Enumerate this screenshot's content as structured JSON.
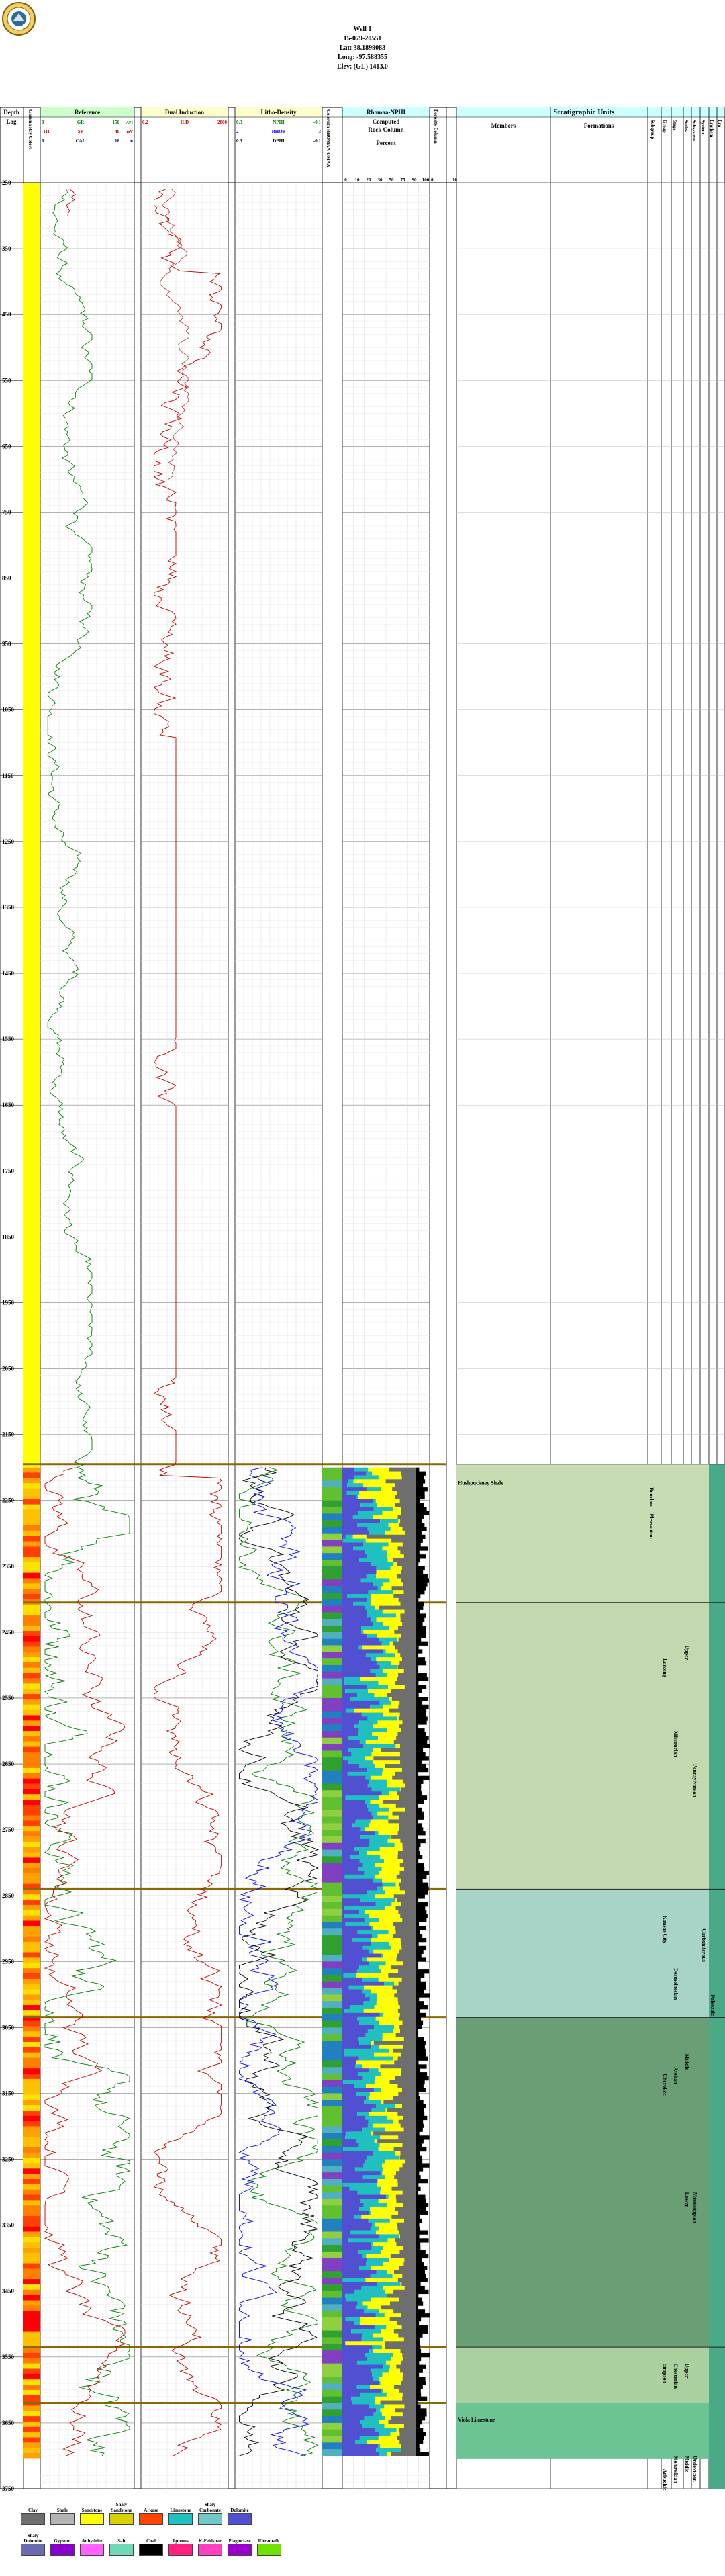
{
  "header": {
    "well_name": "Well 1",
    "api": "15-079-20551",
    "lat": "Lat: 38.1899083",
    "long": "Long: -97.588355",
    "elev": "Elev: (GL) 1413.0"
  },
  "columns": {
    "depth_title": "Depth",
    "depth_sub": "Log",
    "gr_col": "Gamma Ray Colors",
    "reference": "Reference",
    "dual_induction": "Dual Induction",
    "litho_density": "Litho-Density",
    "cali_col": "Colorlith RHOMAA-UMAA",
    "rhomaa": "Rhomaa-NPHI",
    "rhomaa_sub1": "Computed",
    "rhomaa_sub2": "Rock Column",
    "rhomaa_sub3": "Percent",
    "porosity": "Porosity Column",
    "porosity_scale": [
      "0",
      "10"
    ],
    "strat_title": "Stratigraphic Units",
    "members": "Members",
    "formations": "Formations",
    "strat_vertical": [
      "Subgroup",
      "Group",
      "Stage",
      "Series",
      "Subsystem",
      "System",
      "Erathem",
      "Era"
    ],
    "rhomaa_scale": [
      "0",
      "10",
      "20",
      "30",
      "50",
      "75",
      "90",
      "100"
    ]
  },
  "curve_scales": {
    "reference": [
      {
        "left": "0",
        "name": "GR",
        "right": "150",
        "unit": "API",
        "color": "#008000"
      },
      {
        "left": "-111",
        "name": "SP",
        "right": "-40",
        "unit": "mV",
        "color": "#c00000"
      },
      {
        "left": "6",
        "name": "CAL",
        "right": "16",
        "unit": "in",
        "color": "#000080"
      }
    ],
    "dual_induction": [
      {
        "left": "0.2",
        "name": "ILD",
        "right": "2000",
        "color": "#c00000"
      }
    ],
    "litho_density": [
      {
        "left": "0.3",
        "name": "NPHI",
        "right": "-0.1",
        "color": "#008000"
      },
      {
        "left": "2",
        "name": "RHOB",
        "right": "3",
        "color": "#0000ff"
      },
      {
        "left": "0.3",
        "name": "DPHI",
        "right": "-0.1",
        "color": "#000000"
      }
    ]
  },
  "depths": [
    "250",
    "350",
    "450",
    "550",
    "650",
    "750",
    "850",
    "950",
    "1050",
    "1150",
    "1250",
    "1350",
    "1450",
    "1550",
    "1650",
    "1750",
    "1850",
    "1950",
    "2050",
    "2150",
    "2250",
    "2350",
    "2450",
    "2550",
    "2650",
    "2750",
    "2850",
    "2950",
    "3050",
    "3150",
    "3250",
    "3350",
    "3450",
    "3550",
    "3650",
    "3750"
  ],
  "strat_labels": {
    "members": [
      {
        "depth": 2218,
        "text": "Hushpuckney Shale"
      },
      {
        "depth": 3640,
        "text": "Viola Limestone"
      }
    ],
    "subgroup": [
      {
        "depth": 2230,
        "text": "Bourbon"
      },
      {
        "depth": 2270,
        "text": "Pleasanton"
      }
    ],
    "group": [
      {
        "depth": 2490,
        "text": "Lansing"
      },
      {
        "depth": 2880,
        "text": "Kansas City"
      },
      {
        "depth": 3120,
        "text": "Cherokee"
      },
      {
        "depth": 3560,
        "text": "Simpson"
      },
      {
        "depth": 3720,
        "text": "Arbuckle"
      }
    ],
    "stage": [
      {
        "depth": 2600,
        "text": "Missourian"
      },
      {
        "depth": 2960,
        "text": "Desmoinesian"
      },
      {
        "depth": 3110,
        "text": "Atokan"
      },
      {
        "depth": 3560,
        "text": "Chesterian"
      },
      {
        "depth": 3700,
        "text": "Mohawkian"
      }
    ],
    "series": [
      {
        "depth": 2470,
        "text": "Upper"
      },
      {
        "depth": 3090,
        "text": "Middle"
      },
      {
        "depth": 3300,
        "text": "Lower"
      },
      {
        "depth": 3560,
        "text": "Upper"
      },
      {
        "depth": 3700,
        "text": "Middle"
      }
    ],
    "subsystem": [
      {
        "depth": 2650,
        "text": "Pennsylvanian"
      },
      {
        "depth": 3300,
        "text": "Mississippian"
      },
      {
        "depth": 3700,
        "text": "Ordovician"
      }
    ],
    "system": [
      {
        "depth": 2900,
        "text": "Carboniferous"
      }
    ],
    "erathem": [
      {
        "depth": 3000,
        "text": "Paleozoic"
      }
    ]
  },
  "legend": {
    "row1": [
      {
        "name": "Clay",
        "color": "#6e6e6e"
      },
      {
        "name": "Shale",
        "color": "#b4b4b4"
      },
      {
        "name": "Sandstone",
        "color": "#ffff00"
      },
      {
        "name": "Shaly Sandstone",
        "color": "#d8d000"
      },
      {
        "name": "Arkose",
        "color": "#ff4500"
      },
      {
        "name": "Limestone",
        "color": "#20c0c0"
      },
      {
        "name": "Shaly Carbonate",
        "color": "#70c8c8"
      },
      {
        "name": "Dolomite",
        "color": "#5050d0"
      }
    ],
    "row2": [
      {
        "name": "Shaly Dolomite",
        "color": "#6a6ab0"
      },
      {
        "name": "Gypsum",
        "color": "#8800cc"
      },
      {
        "name": "Anhydrite",
        "color": "#ff60ff"
      },
      {
        "name": "Salt",
        "color": "#70d8b8"
      },
      {
        "name": "Coal",
        "color": "#000000"
      },
      {
        "name": "Igneous",
        "color": "#ff2080"
      },
      {
        "name": "K-Feldspar",
        "color": "#ff40c0"
      },
      {
        "name": "Plagioclase",
        "color": "#9900cc"
      },
      {
        "name": "Ultramafic",
        "color": "#70e000"
      }
    ]
  }
}
